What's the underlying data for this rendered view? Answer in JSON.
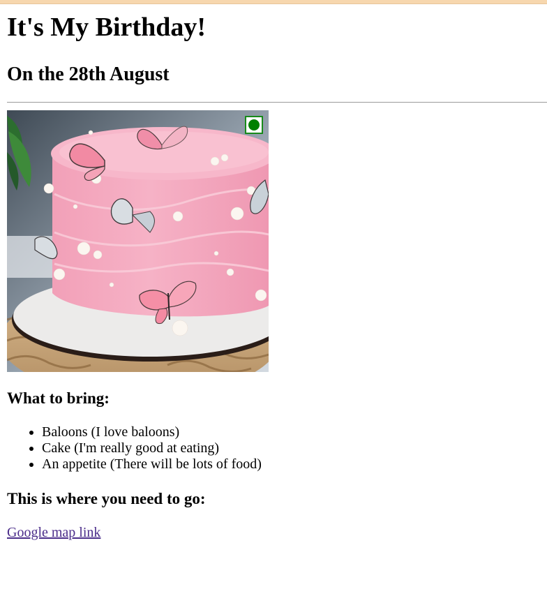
{
  "page": {
    "title": "It's My Birthday!",
    "date_heading": "On the 28th August",
    "bring_heading": "What to bring:",
    "bring_items": [
      "Baloons (I love baloons)",
      "Cake (I'm really good at eating)",
      "An appetite (There will be lots of food)"
    ],
    "location_heading": "This is where you need to go:",
    "map_link_text": "Google map link"
  },
  "image": {
    "subject": "pink butterfly cake",
    "badge": "veg-mark-icon"
  },
  "colors": {
    "link": "#4b2d8a",
    "veg_mark": "#008000",
    "top_strip": "#f7d7ae"
  }
}
